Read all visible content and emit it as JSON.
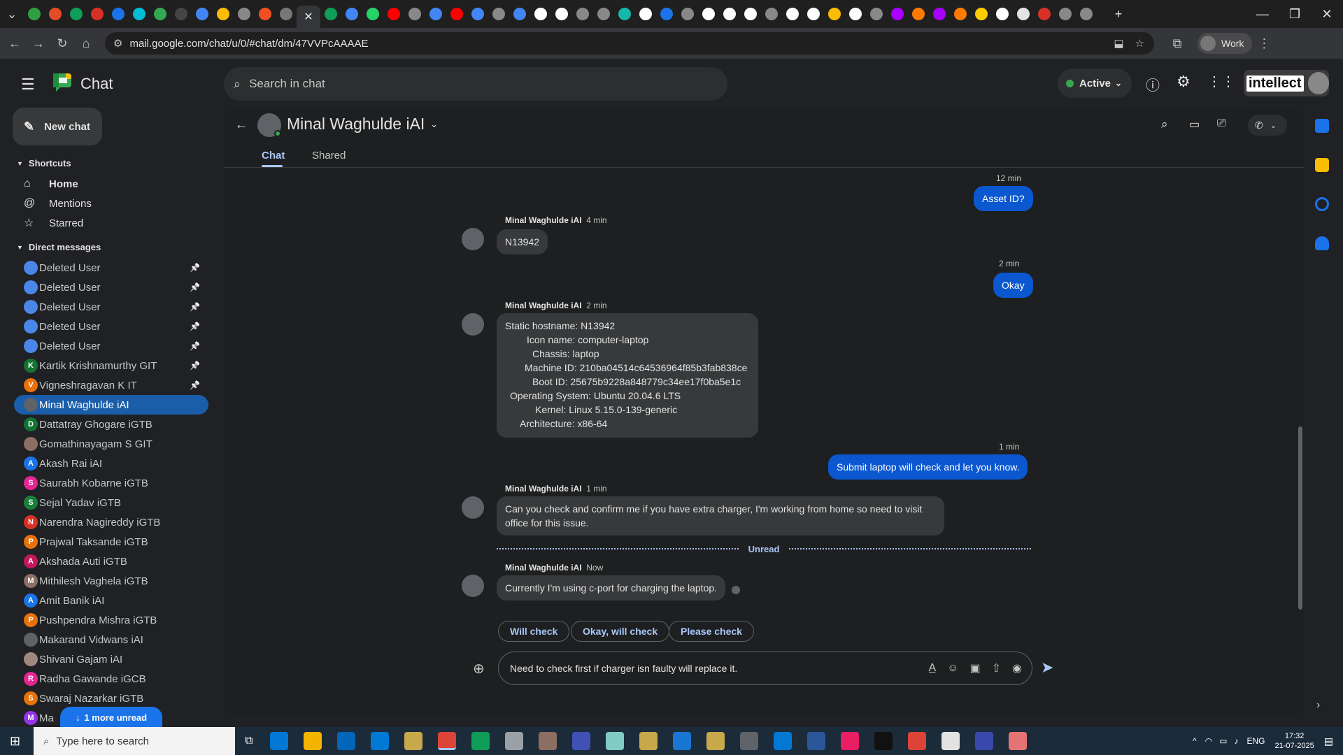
{
  "browser": {
    "url": "mail.google.com/chat/u/0/#chat/dm/47VVPcAAAAE",
    "profile_label": "Work",
    "tab_colors": [
      "#2ea043",
      "#e34c26",
      "#0f9d58",
      "#d93025",
      "#1a73e8",
      "#00bcd4",
      "#34a853",
      "#444",
      "#4285f4",
      "#fbbc04",
      "#888",
      "#f25022",
      "#777",
      "#0f9d58",
      "#4285f4",
      "#25d366",
      "#ff0000",
      "#888",
      "#4285f4",
      "#ff0000",
      "#4285f4",
      "#888",
      "#4285f4",
      "#fff",
      "#fff",
      "#888",
      "#888",
      "#14b8a6",
      "#fff",
      "#1a73e8",
      "#888",
      "#fff",
      "#fff",
      "#fff",
      "#888",
      "#fff",
      "#fff",
      "#fbbc04",
      "#fff",
      "#888",
      "#aa00ff",
      "#ff7a00",
      "#aa00ff",
      "#ff7a00",
      "#ffcc00",
      "#fff",
      "#e3e3e3",
      "#d93025",
      "#888",
      "#888"
    ]
  },
  "app": {
    "name": "Chat",
    "search_placeholder": "Search in chat",
    "status": "Active",
    "org_label": "intellect"
  },
  "sidebar": {
    "new_chat": "New chat",
    "shortcuts_title": "Shortcuts",
    "shortcuts": [
      {
        "label": "Home",
        "icon": "home-icon"
      },
      {
        "label": "Mentions",
        "icon": "at-icon"
      },
      {
        "label": "Starred",
        "icon": "star-icon"
      }
    ],
    "dm_title": "Direct messages",
    "dms": [
      {
        "label": "Deleted User",
        "initial": "",
        "color": "#4a86e8",
        "pinned": true
      },
      {
        "label": "Deleted User",
        "initial": "",
        "color": "#4a86e8",
        "pinned": true
      },
      {
        "label": "Deleted User",
        "initial": "",
        "color": "#4a86e8",
        "pinned": true
      },
      {
        "label": "Deleted User",
        "initial": "",
        "color": "#4a86e8",
        "pinned": true
      },
      {
        "label": "Deleted User",
        "initial": "",
        "color": "#4a86e8",
        "pinned": true
      },
      {
        "label": "Kartik Krishnamurthy GIT",
        "initial": "K",
        "color": "#137333",
        "pinned": true
      },
      {
        "label": "Vigneshragavan K IT",
        "initial": "V",
        "color": "#e8710a",
        "pinned": true
      },
      {
        "label": "Minal Waghulde iAI",
        "initial": "",
        "color": "#5f6368",
        "pinned": false,
        "selected": true
      },
      {
        "label": "Dattatray Ghogare iGTB",
        "initial": "D",
        "color": "#137333",
        "pinned": false
      },
      {
        "label": "Gomathinayagam S GIT",
        "initial": "",
        "color": "#8d6e63",
        "pinned": false
      },
      {
        "label": "Akash Rai iAI",
        "initial": "A",
        "color": "#1a73e8",
        "pinned": false
      },
      {
        "label": "Saurabh Kobarne iGTB",
        "initial": "S",
        "color": "#e52592",
        "pinned": false
      },
      {
        "label": "Sejal Yadav iGTB",
        "initial": "S",
        "color": "#188038",
        "pinned": false
      },
      {
        "label": "Narendra Nagireddy iGTB",
        "initial": "N",
        "color": "#d93025",
        "pinned": false
      },
      {
        "label": "Prajwal Taksande iGTB",
        "initial": "P",
        "color": "#e8710a",
        "pinned": false
      },
      {
        "label": "Akshada Auti iGTB",
        "initial": "A",
        "color": "#c2185b",
        "pinned": false
      },
      {
        "label": "Mithilesh Vaghela iGTB",
        "initial": "M",
        "color": "#8d6e63",
        "pinned": false
      },
      {
        "label": "Amit Banik iAI",
        "initial": "A",
        "color": "#1a73e8",
        "pinned": false
      },
      {
        "label": "Pushpendra Mishra iGTB",
        "initial": "P",
        "color": "#e8710a",
        "pinned": false
      },
      {
        "label": "Makarand Vidwans iAI",
        "initial": "",
        "color": "#5f6368",
        "pinned": false
      },
      {
        "label": "Shivani Gajam iAI",
        "initial": "",
        "color": "#a1887f",
        "pinned": false
      },
      {
        "label": "Radha Gawande iGCB",
        "initial": "R",
        "color": "#e52592",
        "pinned": false
      },
      {
        "label": "Swaraj Nazarkar iGTB",
        "initial": "S",
        "color": "#e8710a",
        "pinned": false
      },
      {
        "label": "Ma",
        "initial": "M",
        "color": "#9334e6",
        "pinned": false
      }
    ],
    "more_unread": "1 more unread"
  },
  "conversation": {
    "title": "Minal Waghulde iAI",
    "tabs": [
      "Chat",
      "Shared"
    ],
    "messages": [
      {
        "side": "out",
        "time": "12 min",
        "text": "Asset ID?"
      },
      {
        "side": "in",
        "sender": "Minal Waghulde iAI",
        "time": "4 min",
        "text": "N13942"
      },
      {
        "side": "out",
        "time": "2 min",
        "text": "Okay"
      },
      {
        "side": "in",
        "sender": "Minal Waghulde iAI",
        "time": "2 min",
        "lines": [
          "Static hostname: N13942",
          "Icon name: computer-laptop",
          "Chassis: laptop",
          "Machine ID: 210ba04514c64536964f85b3fab838ce",
          "Boot ID: 25675b9228a848779c34ee17f0ba5e1c",
          "Operating System: Ubuntu 20.04.6 LTS",
          "Kernel: Linux 5.15.0-139-generic",
          "Architecture: x86-64"
        ]
      },
      {
        "side": "out",
        "time": "1 min",
        "text": "Submit laptop will check and let you know."
      },
      {
        "side": "in",
        "sender": "Minal Waghulde iAI",
        "time": "1 min",
        "lines": [
          "Can you check and confirm me if you have extra charger, I'm working from home so need to visit",
          "office for this issue."
        ]
      },
      {
        "side": "in",
        "sender": "Minal Waghulde iAI",
        "time": "Now",
        "text": "Currently I'm using c-port for charging the laptop."
      }
    ],
    "unread_label": "Unread",
    "smart_replies": [
      "Will check",
      "Okay, will check",
      "Please check"
    ],
    "composer_text": "Need to check first if charger isn faulty will replace it."
  },
  "taskbar": {
    "search_placeholder": "Type here to search",
    "language": "ENG",
    "time": "17:32",
    "date": "21-07-2025"
  }
}
